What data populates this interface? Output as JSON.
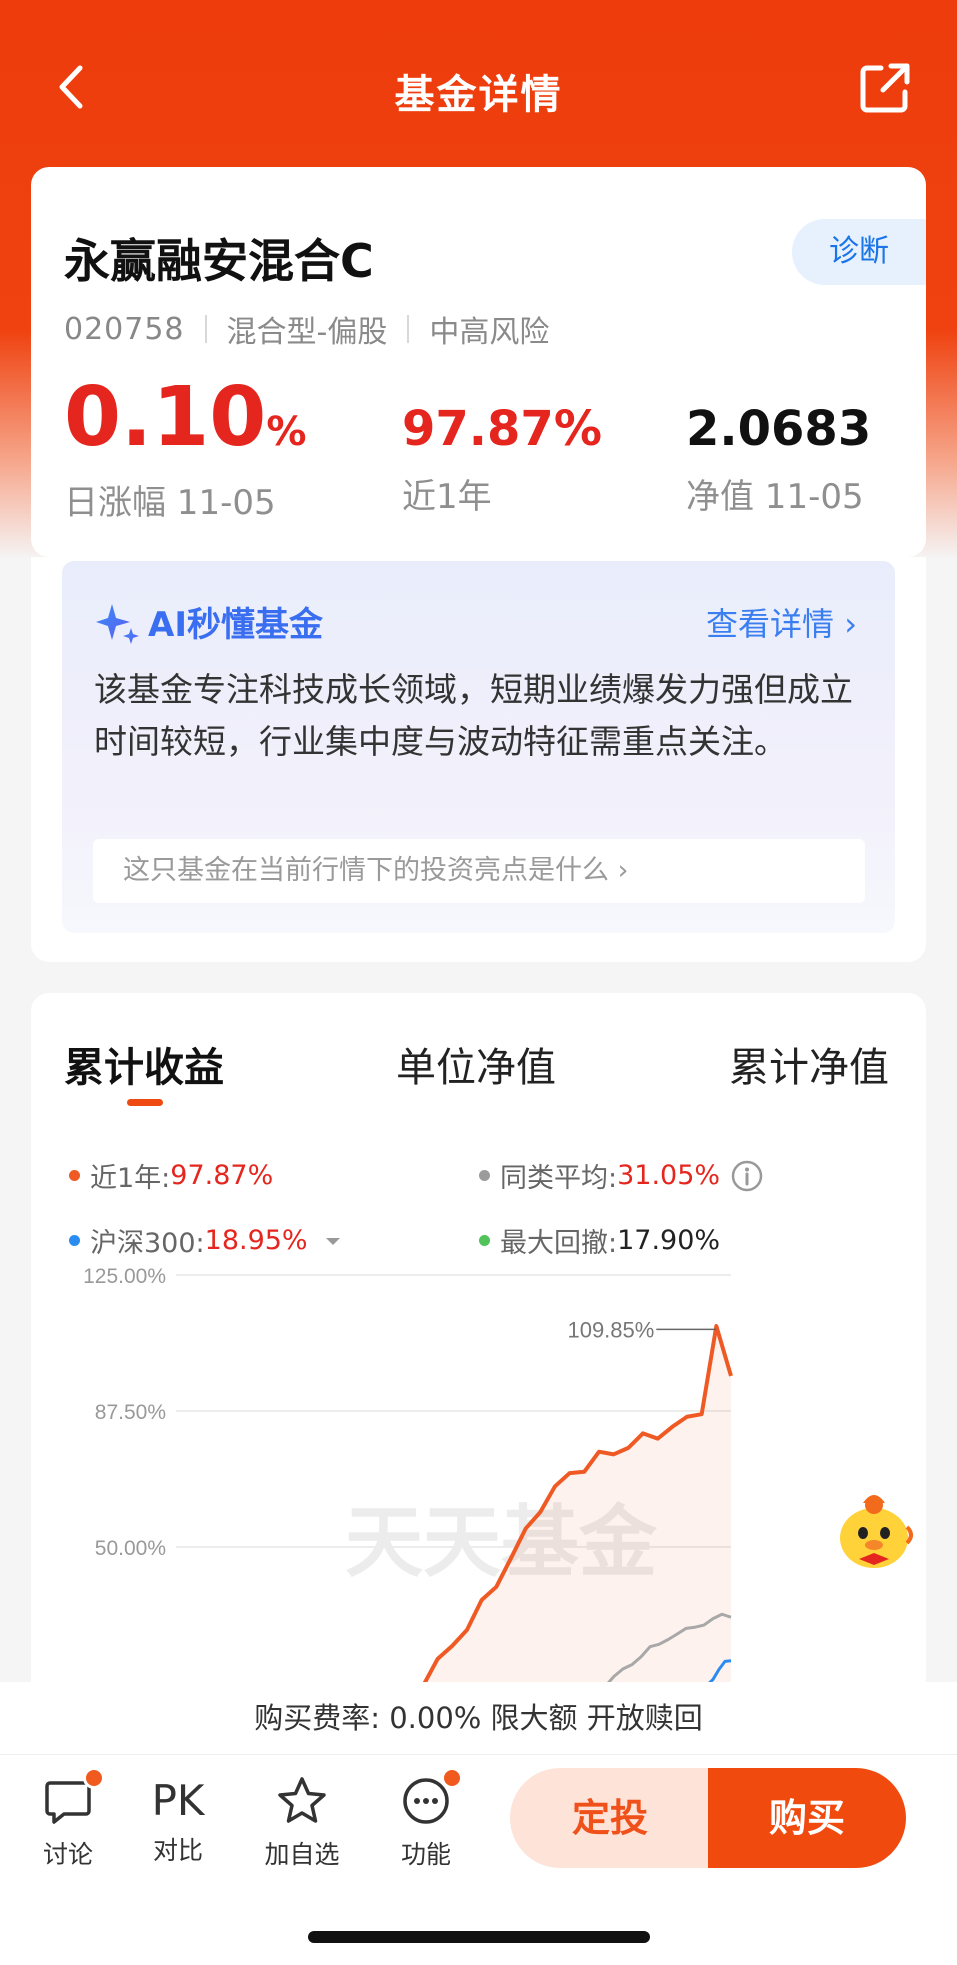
{
  "nav": {
    "title": "基金详情"
  },
  "fund": {
    "name": "永赢融安混合C",
    "diagnose_label": "诊断",
    "code": "020758",
    "type": "混合型-偏股",
    "risk": "中高风险",
    "daily_change": "0.10",
    "daily_change_unit": "%",
    "daily_change_label": "日涨幅 11-05",
    "year_return": "97.87%",
    "year_return_label": "近1年",
    "nav_value": "2.0683",
    "nav_label": "净值 11-05"
  },
  "ai": {
    "title": "AI秒懂基金",
    "more_label": "查看详情 ›",
    "summary": "该基金专注科技成长领域，短期业绩爆发力强但成立时间较短，行业集中度与波动特征需重点关注。",
    "question": "这只基金在当前行情下的投资亮点是什么 ›"
  },
  "chart_section": {
    "tabs": [
      "累计收益",
      "单位净值",
      "累计净值"
    ],
    "active_tab": 0,
    "legend": {
      "year_label": "近1年:",
      "year_value": "97.87%",
      "peer_label": "同类平均:",
      "peer_value": "31.05%",
      "index_label": "沪深300:",
      "index_value": "18.95%",
      "drawdown_label": "最大回撤:",
      "drawdown_value": "17.90%"
    },
    "watermark": "天天基金",
    "peak_label": "109.85%"
  },
  "chart_data": {
    "type": "line",
    "ylim": [
      12.5,
      125
    ],
    "y_ticks": [
      "125.00%",
      "87.50%",
      "50.00%"
    ],
    "series": [
      {
        "name": "近1年",
        "color": "#ef5a24",
        "values": [
          -2,
          -1,
          0,
          1,
          2,
          3,
          4,
          6,
          9,
          13,
          18,
          23,
          28,
          34,
          40,
          47,
          54,
          61,
          66,
          70,
          72,
          75,
          76,
          78,
          80,
          81,
          83,
          85,
          88,
          110,
          97
        ]
      },
      {
        "name": "同类平均",
        "color": "#a8a8a8",
        "values": [
          0,
          0,
          0,
          0,
          0,
          1,
          1,
          1,
          2,
          3,
          4,
          5,
          6,
          7,
          9,
          10,
          12,
          14,
          16,
          18,
          20,
          22,
          23,
          25,
          26,
          27,
          28,
          29,
          30,
          31,
          31
        ]
      },
      {
        "name": "沪深300",
        "color": "#2a8cf0",
        "values": [
          0,
          0,
          0,
          0,
          0,
          0,
          0,
          0,
          0,
          0,
          0,
          1,
          1,
          1,
          2,
          2,
          3,
          3,
          4,
          5,
          6,
          7,
          8,
          9,
          10,
          11,
          12,
          14,
          16,
          18,
          19
        ]
      }
    ]
  },
  "colors": {
    "brand": "#ef4210",
    "up": "#e5261e",
    "ai_blue": "#3a6ef0"
  },
  "footer": {
    "fee_text": "购买费率: 0.00% 限大额 开放赎回",
    "items": [
      {
        "icon": "comment-icon",
        "label": "讨论"
      },
      {
        "icon": "pk-text",
        "label": "对比",
        "glyph": "PK"
      },
      {
        "icon": "star-icon",
        "label": "加自选"
      },
      {
        "icon": "more-icon",
        "label": "功能"
      }
    ],
    "dingtou_label": "定投",
    "buy_label": "购买"
  }
}
